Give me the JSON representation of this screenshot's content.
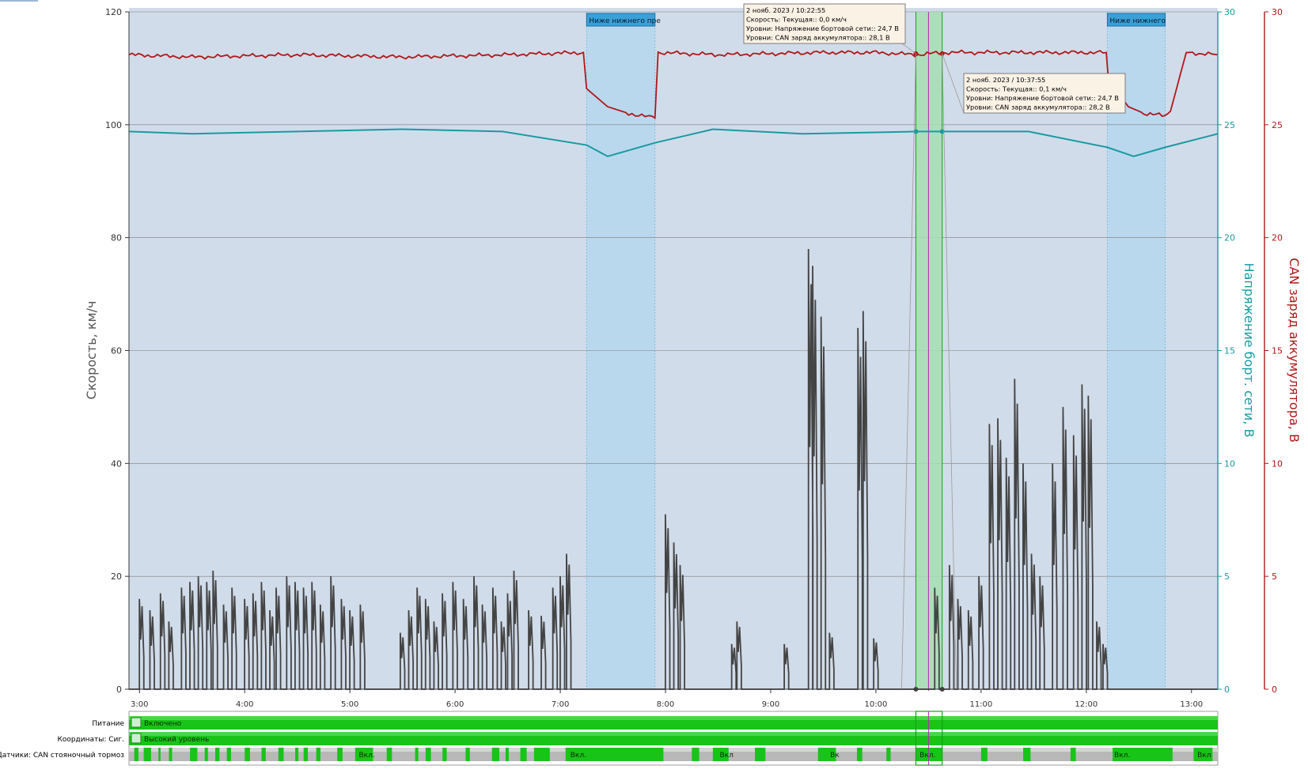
{
  "chart_data": {
    "type": "line",
    "xlabel": "",
    "x_ticks": [
      "3:00",
      "4:00",
      "5:00",
      "6:00",
      "7:00",
      "8:00",
      "9:00",
      "10:00",
      "11:00",
      "12:00",
      "13:00"
    ],
    "x_range_hours": [
      2.9,
      13.25
    ],
    "left_axis": {
      "label": "Скорость, км/ч",
      "range": [
        0,
        120
      ],
      "ticks": [
        "0",
        "20",
        "40",
        "60",
        "80",
        "100",
        "120"
      ]
    },
    "mid_axis": {
      "label": "Напряжение борт. сети, В",
      "range": [
        0,
        30
      ],
      "ticks": [
        "0",
        "5",
        "10",
        "15",
        "20",
        "25",
        "30"
      ],
      "color": "#1a9aa0"
    },
    "right_axis": {
      "label": "CAN заряд аккумулятора, В",
      "range": [
        0,
        30
      ],
      "ticks": [
        "0",
        "5",
        "10",
        "15",
        "20",
        "25",
        "30"
      ],
      "color": "#b01818"
    },
    "series": [
      {
        "name": "Скорость",
        "axis": "left",
        "color": "#444444",
        "bursts": [
          [
            3.02,
            16
          ],
          [
            3.12,
            14
          ],
          [
            3.22,
            17
          ],
          [
            3.3,
            12
          ],
          [
            3.42,
            18
          ],
          [
            3.5,
            19
          ],
          [
            3.58,
            20
          ],
          [
            3.66,
            19
          ],
          [
            3.72,
            21
          ],
          [
            3.82,
            15
          ],
          [
            3.9,
            18
          ],
          [
            4.02,
            16
          ],
          [
            4.1,
            17
          ],
          [
            4.18,
            19
          ],
          [
            4.26,
            14
          ],
          [
            4.32,
            18
          ],
          [
            4.42,
            20
          ],
          [
            4.5,
            19
          ],
          [
            4.58,
            18
          ],
          [
            4.66,
            19
          ],
          [
            4.74,
            15
          ],
          [
            4.84,
            20
          ],
          [
            4.94,
            16
          ],
          [
            5.02,
            14
          ],
          [
            5.12,
            15
          ],
          [
            5.5,
            10
          ],
          [
            5.58,
            14
          ],
          [
            5.66,
            18
          ],
          [
            5.74,
            16
          ],
          [
            5.82,
            12
          ],
          [
            5.9,
            17
          ],
          [
            6.0,
            19
          ],
          [
            6.1,
            16
          ],
          [
            6.2,
            20
          ],
          [
            6.28,
            15
          ],
          [
            6.38,
            18
          ],
          [
            6.46,
            12
          ],
          [
            6.52,
            17
          ],
          [
            6.58,
            21
          ],
          [
            6.72,
            14
          ],
          [
            6.84,
            13
          ],
          [
            6.95,
            18
          ],
          [
            7.02,
            20
          ],
          [
            7.08,
            24
          ],
          [
            8.02,
            31
          ],
          [
            8.1,
            26
          ],
          [
            8.16,
            22
          ],
          [
            8.65,
            8
          ],
          [
            8.7,
            12
          ],
          [
            9.15,
            8
          ],
          [
            9.38,
            78
          ],
          [
            9.42,
            75
          ],
          [
            9.5,
            66
          ],
          [
            9.58,
            10
          ],
          [
            9.85,
            64
          ],
          [
            9.9,
            67
          ],
          [
            10.0,
            9
          ],
          [
            10.58,
            18
          ],
          [
            10.72,
            22
          ],
          [
            10.8,
            16
          ],
          [
            10.9,
            14
          ],
          [
            11.0,
            20
          ],
          [
            11.1,
            47
          ],
          [
            11.18,
            48
          ],
          [
            11.26,
            41
          ],
          [
            11.34,
            55
          ],
          [
            11.42,
            40
          ],
          [
            11.5,
            24
          ],
          [
            11.58,
            20
          ],
          [
            11.7,
            40
          ],
          [
            11.8,
            50
          ],
          [
            11.9,
            45
          ],
          [
            11.98,
            54
          ],
          [
            12.04,
            52
          ],
          [
            12.12,
            12
          ],
          [
            12.18,
            8
          ]
        ]
      },
      {
        "name": "Напряжение бортовой сети",
        "axis": "mid",
        "color": "#1a9aa0",
        "x": [
          2.9,
          3.5,
          4.5,
          5.5,
          6.45,
          7.25,
          7.45,
          7.9,
          8.45,
          9.3,
          10.4,
          11.45,
          12.2,
          12.45,
          12.75,
          13.25
        ],
        "values": [
          24.7,
          24.6,
          24.7,
          24.8,
          24.7,
          24.1,
          23.6,
          24.2,
          24.8,
          24.6,
          24.7,
          24.7,
          24.0,
          23.6,
          24.0,
          24.6
        ]
      },
      {
        "name": "CAN заряд аккумулятора",
        "axis": "right",
        "color": "#b01818",
        "x": [
          2.9,
          3.5,
          4.5,
          5.5,
          6.5,
          7.22,
          7.25,
          7.45,
          7.65,
          7.9,
          7.93,
          8.5,
          9.5,
          10.0,
          10.4,
          10.63,
          11.0,
          11.5,
          12.19,
          12.21,
          12.4,
          12.55,
          12.75,
          12.8,
          12.95,
          13.25
        ],
        "values": [
          28.1,
          28.0,
          28.1,
          28.0,
          28.1,
          28.2,
          26.6,
          25.8,
          25.5,
          25.3,
          28.2,
          28.1,
          28.2,
          28.2,
          28.1,
          28.2,
          28.2,
          28.2,
          28.2,
          27.0,
          25.8,
          25.5,
          25.4,
          25.6,
          28.2,
          28.1
        ]
      }
    ],
    "alarm_bands": [
      {
        "from": 7.25,
        "to": 7.9,
        "label": "Ниже нижнего пре"
      },
      {
        "from": 12.2,
        "to": 12.75,
        "label": "Ниже нижнего"
      }
    ],
    "selection": {
      "from": 10.38,
      "to": 10.63,
      "cursor": 10.5
    },
    "tooltips": [
      {
        "at": 10.38,
        "lines": [
          "2 нояб. 2023 / 10:22:55",
          "Скорость: Текущая:: 0,0 км/ч",
          "Уровни: Напряжение бортовой сети:: 24,7 В",
          "Уровни: CAN заряд аккумулятора:: 28,1 В"
        ]
      },
      {
        "at": 10.63,
        "lines": [
          "2 нояб. 2023 / 10:37:55",
          "Скорость: Текущая:: 0,1 км/ч",
          "Уровни: Напряжение бортовой сети:: 24,7 В",
          "Уровни: CAN заряд аккумулятора:: 28,2 В"
        ]
      }
    ],
    "grid": true
  },
  "tracks": [
    {
      "label": "Питание",
      "text": "Включено",
      "icon": "power-plug-icon"
    },
    {
      "label": "Координаты: Сиг.",
      "text": "Высокий уровень",
      "icon": "satellite-icon"
    },
    {
      "label": "Датчики: CAN стояночный тормоз",
      "labels": [
        [
          5.07,
          "Вкл."
        ],
        [
          7.08,
          "Вкл."
        ],
        [
          8.5,
          "Вкл"
        ],
        [
          9.55,
          "Вк"
        ],
        [
          10.4,
          "Вкл."
        ],
        [
          12.25,
          "Вкл."
        ],
        [
          13.04,
          "Вкл"
        ]
      ],
      "on_segments": [
        [
          2.95,
          2.99
        ],
        [
          3.04,
          3.11
        ],
        [
          3.18,
          3.2
        ],
        [
          3.28,
          3.31
        ],
        [
          3.48,
          3.55
        ],
        [
          3.62,
          3.65
        ],
        [
          3.72,
          3.76
        ],
        [
          3.83,
          3.87
        ],
        [
          4.0,
          4.05
        ],
        [
          4.16,
          4.2
        ],
        [
          4.32,
          4.37
        ],
        [
          4.48,
          4.51
        ],
        [
          4.56,
          4.6
        ],
        [
          4.68,
          4.72
        ],
        [
          4.88,
          4.93
        ],
        [
          5.05,
          5.22
        ],
        [
          5.35,
          5.4
        ],
        [
          5.62,
          5.65
        ],
        [
          5.72,
          5.77
        ],
        [
          5.88,
          5.92
        ],
        [
          6.1,
          6.14
        ],
        [
          6.35,
          6.42
        ],
        [
          6.48,
          6.51
        ],
        [
          6.62,
          6.68
        ],
        [
          6.75,
          6.9
        ],
        [
          7.05,
          7.98
        ],
        [
          8.25,
          8.32
        ],
        [
          8.45,
          8.6
        ],
        [
          8.85,
          8.95
        ],
        [
          9.45,
          9.62
        ],
        [
          9.82,
          9.87
        ],
        [
          10.1,
          10.14
        ],
        [
          10.38,
          10.63
        ],
        [
          11.0,
          11.06
        ],
        [
          11.4,
          11.47
        ],
        [
          11.85,
          11.9
        ],
        [
          12.25,
          12.82
        ],
        [
          13.02,
          13.2
        ]
      ]
    }
  ]
}
